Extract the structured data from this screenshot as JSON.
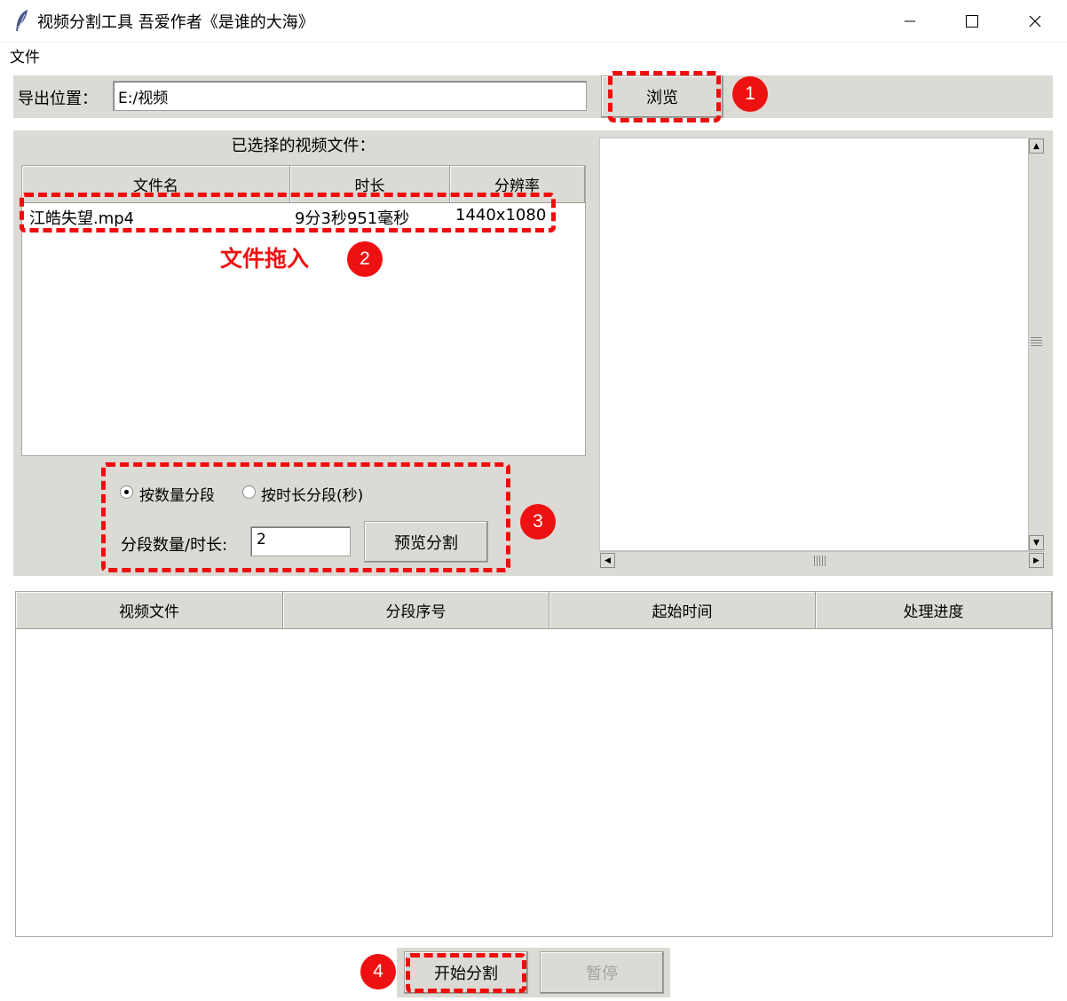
{
  "window": {
    "title": "视频分割工具 吾爱作者《是谁的大海》",
    "controls": {
      "minimize": "—",
      "maximize": "☐",
      "close": "✕"
    }
  },
  "menu": {
    "items": [
      "文件"
    ]
  },
  "export": {
    "label": "导出位置：",
    "path": "E:/视频",
    "browse_label": "浏览"
  },
  "file_list": {
    "title": "已选择的视频文件：",
    "columns": [
      "文件名",
      "时长",
      "分辨率"
    ],
    "rows": [
      {
        "name": "江皓失望.mp4",
        "duration": "9分3秒951毫秒",
        "resolution": "1440x1080"
      }
    ]
  },
  "split_options": {
    "mode_count_label": "按数量分段",
    "mode_duration_label": "按时长分段(秒)",
    "selected_mode": "count",
    "segment_label": "分段数量/时长:",
    "segment_value": "2",
    "preview_label": "预览分割"
  },
  "results": {
    "columns": [
      "视频文件",
      "分段序号",
      "起始时间",
      "处理进度"
    ],
    "rows": []
  },
  "actions": {
    "start_label": "开始分割",
    "pause_label": "暂停"
  },
  "annotations": {
    "step1": "1",
    "step2": "2",
    "step3": "3",
    "step4": "4",
    "drag_note": "文件拖入",
    "color": "#ee1111"
  },
  "colors": {
    "panel_bg": "#dcdad5",
    "window_bg": "#ffffff"
  }
}
